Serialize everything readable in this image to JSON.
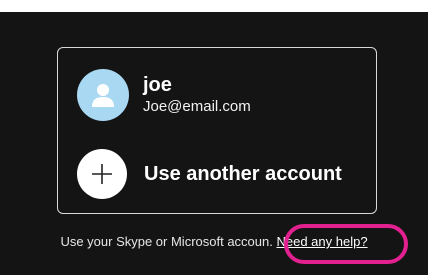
{
  "account": {
    "name": "joe",
    "email": "Joe@email.com",
    "avatar_icon": "person-icon",
    "avatar_color": "#a9d8f3"
  },
  "another": {
    "label": "Use another account",
    "icon": "plus-icon"
  },
  "footer": {
    "text": "Use your Skype or Microsoft accoun",
    "separator": ". ",
    "help_link": "Need any help?"
  },
  "colors": {
    "background": "#141414",
    "highlight": "#e3208f"
  }
}
